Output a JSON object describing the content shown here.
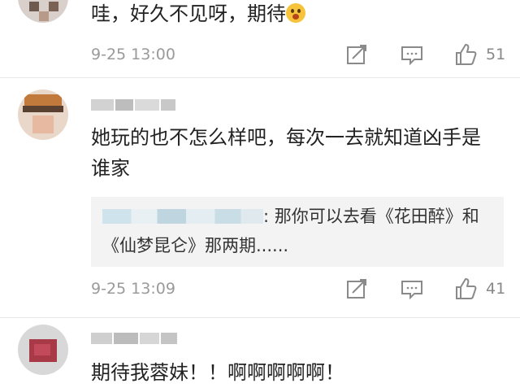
{
  "comments": [
    {
      "text": "哇，好久不见呀，期待",
      "emoji": "scared-face-icon",
      "time": "9-25 13:00",
      "likes": "51"
    },
    {
      "text": "她玩的也不怎么样吧，每次一去就知道凶手是谁家",
      "reply_text": ": 那你可以去看《花田醉》和《仙梦昆仑》那两期......",
      "time": "9-25 13:09",
      "likes": "41"
    },
    {
      "text": "期待我蓉妹！！啊啊啊啊啊！"
    }
  ],
  "icons": {
    "share": "share-icon",
    "comment": "comment-icon",
    "like": "thumbs-up-icon"
  },
  "colors": {
    "text": "#222222",
    "meta": "#9a9a9a",
    "reply_bg": "#f3f3f3",
    "divider": "#e8e8e8"
  }
}
